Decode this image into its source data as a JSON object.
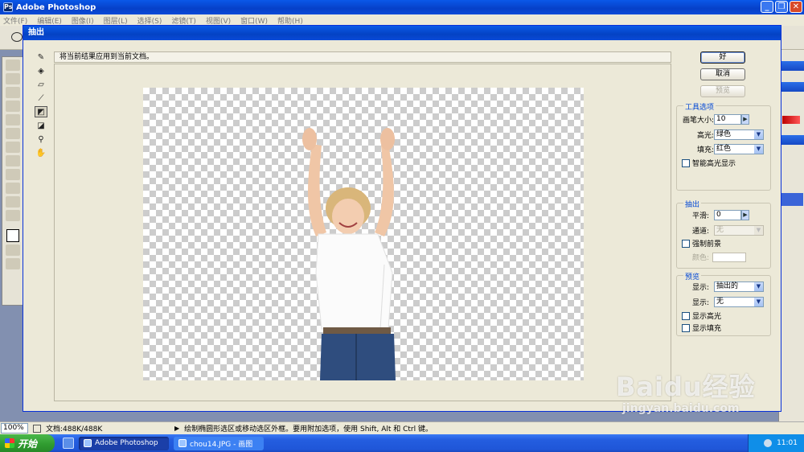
{
  "app": {
    "title": "Adobe Photoshop",
    "menus": [
      "文件(F)",
      "编辑(E)",
      "图像(I)",
      "图层(L)",
      "选择(S)",
      "滤镜(T)",
      "视图(V)",
      "窗口(W)",
      "帮助(H)"
    ],
    "window_buttons": {
      "minimize": "_",
      "restore": "❐",
      "close": "✕"
    }
  },
  "dialog": {
    "title": "抽出",
    "hint": "将当前结果应用到当前文档。",
    "buttons": {
      "ok": "好",
      "cancel": "取消",
      "preview": "预览"
    },
    "tool_options": {
      "title": "工具选项",
      "brush_size_label": "画笔大小:",
      "brush_size_value": "10",
      "highlight_label": "高光:",
      "highlight_value": "绿色",
      "fill_label": "填充:",
      "fill_value": "红色",
      "smart_highlight_label": "智能高光显示",
      "smart_highlight_checked": false
    },
    "extraction": {
      "title": "抽出",
      "smooth_label": "平滑:",
      "smooth_value": "0",
      "channel_label": "通道:",
      "channel_value": "无",
      "force_fg_label": "强制前景",
      "force_fg_checked": false,
      "color_label": "颜色:"
    },
    "preview": {
      "title": "预览",
      "show_label": "显示:",
      "show_value": "抽出的",
      "display_label": "显示:",
      "display_value": "无",
      "show_highlight_label": "显示高光",
      "show_highlight_checked": false,
      "show_fill_label": "显示填充",
      "show_fill_checked": false
    },
    "tools": [
      "edge-highlighter-icon",
      "fill-bucket-icon",
      "eraser-icon",
      "eyedropper-icon",
      "cleanup-tool-icon",
      "edge-touchup-icon",
      "zoom-icon",
      "hand-icon"
    ]
  },
  "statusbar": {
    "zoom": "100%",
    "doc_info": "文档:488K/488K",
    "hint": "绘制椭圆形选区或移动选区外框。要用附加选项，使用 Shift, Alt 和 Ctrl 键。"
  },
  "taskbar": {
    "start": "开始",
    "tasks": [
      {
        "label": "Adobe Photoshop",
        "active": true
      },
      {
        "label": "chou14.JPG - 画图",
        "active": false
      }
    ],
    "clock": "11:01"
  },
  "watermark": {
    "brand": "Baidu经验",
    "url": "jingyan.baidu.com"
  },
  "colors": {
    "titlebar": "#0a58e8",
    "dialog_bg": "#ece9d8",
    "group_title": "#0046d5",
    "start_green": "#2f9a2f"
  }
}
